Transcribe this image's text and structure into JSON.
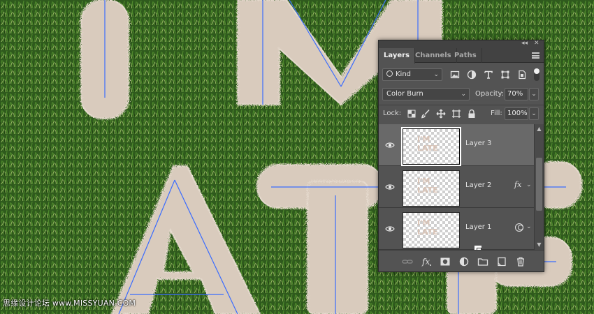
{
  "panel": {
    "tabs": [
      {
        "label": "Layers",
        "active": true
      },
      {
        "label": "Channels",
        "active": false
      },
      {
        "label": "Paths",
        "active": false
      }
    ],
    "filter": {
      "kind_label": "Kind",
      "icons": [
        "image-filter-icon",
        "adjustment-filter-icon",
        "type-filter-icon",
        "shape-filter-icon",
        "smart-object-filter-icon"
      ]
    },
    "blend_mode": "Color Burn",
    "opacity_label": "Opacity:",
    "opacity_value": "70%",
    "lock_label": "Lock:",
    "fill_label": "Fill:",
    "fill_value": "100%",
    "layers": [
      {
        "name": "Layer 3",
        "selected": true,
        "visible": true,
        "badge": "",
        "thumb_text": "I'M\nLATE"
      },
      {
        "name": "Layer 2",
        "selected": false,
        "visible": true,
        "badge": "fx",
        "thumb_text": "I'M\nLATE"
      },
      {
        "name": "Layer 1",
        "selected": false,
        "visible": true,
        "badge": "smart",
        "thumb_text": "I'M\nLATE"
      }
    ],
    "bottom_icons": [
      "link-layers-icon",
      "layer-style-fx-icon",
      "layer-mask-icon",
      "adjustment-layer-icon",
      "new-group-folder-icon",
      "new-layer-icon",
      "delete-trash-icon"
    ],
    "colors": {
      "panel_bg": "#535353",
      "selected_row": "#696969",
      "guide_line": "#3a6cff"
    }
  },
  "watermark": "思缘设计论坛 www.MISSYUAN.COM"
}
